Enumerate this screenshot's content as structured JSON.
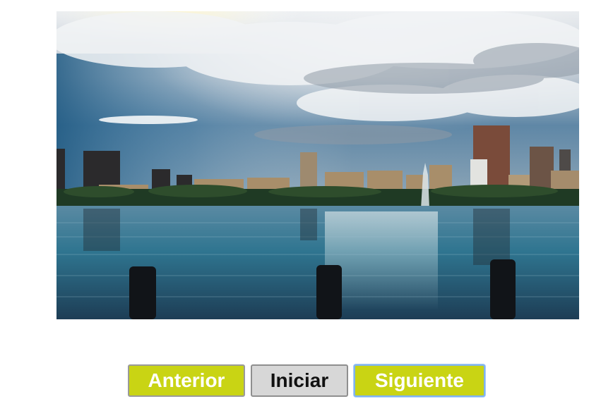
{
  "slideshow": {
    "image": {
      "description_icon": "city-lake-skyline-photo"
    },
    "buttons": {
      "prev_label": "Anterior",
      "start_label": "Iniciar",
      "next_label": "Siguiente"
    },
    "colors": {
      "accent": "#c9d414",
      "neutral": "#d7d7d7"
    }
  }
}
